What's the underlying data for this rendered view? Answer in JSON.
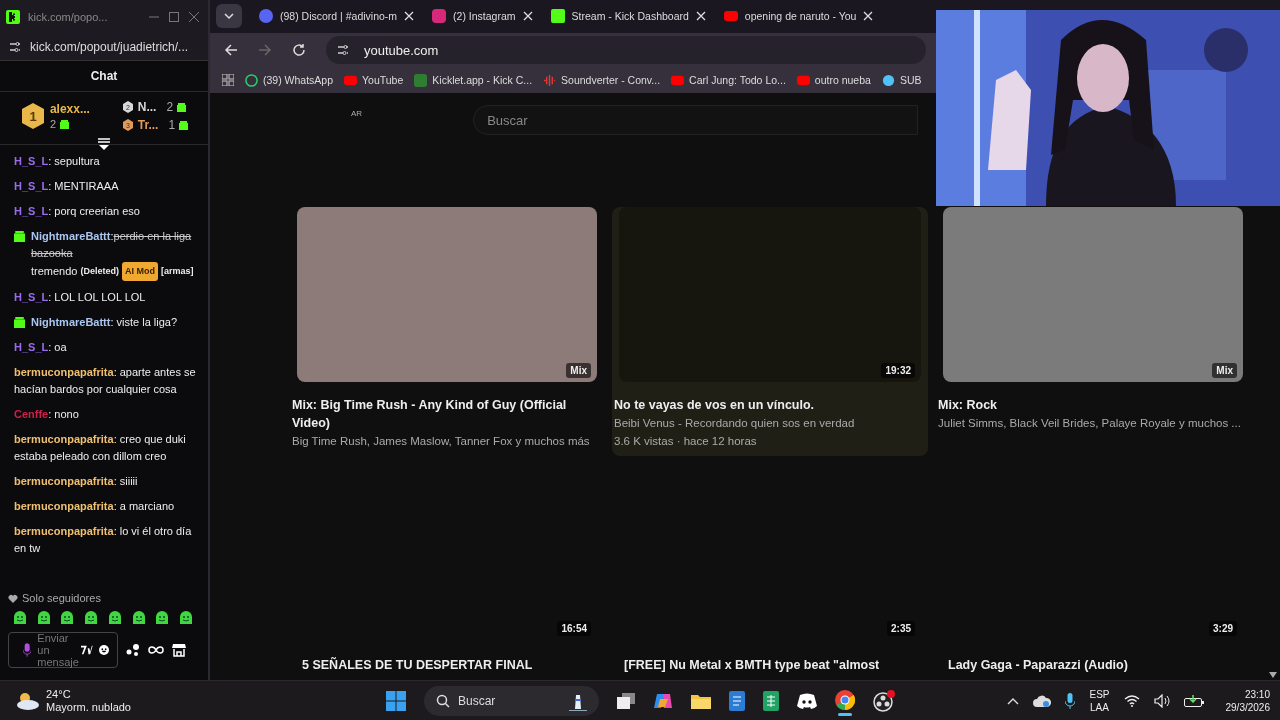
{
  "chat_window": {
    "title": "kick.com/popo...",
    "address": "kick.com/popout/juadietrich/...",
    "header": "Chat",
    "leaders": [
      {
        "rank": "1",
        "name": "alexx...",
        "count": "2",
        "color": "#e8b84a"
      },
      {
        "rank": "2",
        "name": "N...",
        "count": "2",
        "color": "#d8d8d8"
      },
      {
        "rank": "3",
        "name": "Tr...",
        "count": "1",
        "color": "#e09a5c"
      }
    ],
    "messages": [
      {
        "user": "H_S_L",
        "color": "#9b6cf0",
        "gift": false,
        "text": ": sepultura"
      },
      {
        "user": "H_S_L",
        "color": "#9b6cf0",
        "gift": false,
        "text": ": MENTIRAAA"
      },
      {
        "user": "H_S_L",
        "color": "#9b6cf0",
        "gift": false,
        "text": ": porq creerian eso"
      },
      {
        "user": "NightmareBattt",
        "color": "#a9c7f0",
        "gift": true,
        "text": ":",
        "deleted_text": "perdio en la liga bazooka",
        "tail": "tremendo",
        "status": "(Deleted)",
        "tag": "AI Mod",
        "reason": "[armas]"
      },
      {
        "user": "H_S_L",
        "color": "#9b6cf0",
        "gift": false,
        "text": ": LOL LOL LOL LOL"
      },
      {
        "user": "NightmareBattt",
        "color": "#a9c7f0",
        "gift": true,
        "text": ": viste la liga?"
      },
      {
        "user": "H_S_L",
        "color": "#9b6cf0",
        "gift": false,
        "text": ": oa"
      },
      {
        "user": "bermuconpapafrita",
        "color": "#f0c070",
        "gift": false,
        "text": ": aparte antes se hacían bardos por cualquier cosa"
      },
      {
        "user": "Cenffe",
        "color": "#d0204a",
        "gift": false,
        "text": ": nono"
      },
      {
        "user": "bermuconpapafrita",
        "color": "#f0c070",
        "gift": false,
        "text": ": creo que duki estaba peleado con dillom creo"
      },
      {
        "user": "bermuconpapafrita",
        "color": "#f0c070",
        "gift": false,
        "text": ": siiiii"
      },
      {
        "user": "bermuconpapafrita",
        "color": "#f0c070",
        "gift": false,
        "text": ": a marciano"
      },
      {
        "user": "bermuconpapafrita",
        "color": "#f0c070",
        "gift": false,
        "text": ": lo vi él otro día en tw"
      }
    ],
    "mode": "Solo seguidores",
    "input": {
      "placeholder": "Enviar un mensaje"
    }
  },
  "browser": {
    "tabs": [
      {
        "label": "(98) Discord | #adivino-m",
        "selected": false
      },
      {
        "label": "(2) Instagram",
        "selected": false
      },
      {
        "label": "Stream - Kick Dashboard",
        "selected": false
      },
      {
        "label": "opening de naruto - You",
        "selected": false
      }
    ],
    "address": "youtube.com",
    "bookmarks": [
      "(39) WhatsApp",
      "YouTube",
      "Kicklet.app - Kick C...",
      "Soundverter - Conv...",
      "Carl Jung: Todo Lo...",
      "outro nueba",
      "SUB"
    ],
    "region": "AR",
    "search": {
      "placeholder": "Buscar"
    },
    "videos": [
      {
        "badge": "Mix",
        "hovered": false,
        "title": "Mix: Big Time Rush - Any Kind of Guy (Official Video)",
        "lines": [
          "Big Time Rush, James Maslow, Tanner Fox y muchos más"
        ]
      },
      {
        "badge": "19:32",
        "hovered": true,
        "title": "No te vayas de vos en un vínculo.",
        "lines": [
          "Beibi Venus - Recordando quien sos en verdad",
          "3.6 K vistas · hace 12 horas"
        ]
      },
      {
        "badge": "Mix",
        "hovered": false,
        "title": "Mix: Rock",
        "lines": [
          "Juliet Simms, Black Veil Brides, Palaye Royale y muchos ..."
        ]
      }
    ],
    "videos_row2": [
      {
        "badge": "16:54",
        "title": "5 SEÑALES DE TU DESPERTAR FINAL"
      },
      {
        "badge": "2:35",
        "title": "[FREE] Nu Metal x BMTH type beat \"almost"
      },
      {
        "badge": "3:29",
        "title": "Lady Gaga - Paparazzi (Audio)"
      }
    ]
  },
  "taskbar": {
    "weather": {
      "temp": "24°C",
      "desc": "Mayorm. nublado"
    },
    "search": {
      "placeholder": "Buscar"
    },
    "language": [
      "ESP",
      "LAA"
    ],
    "time": "23:10",
    "date": "29/3/2026"
  }
}
